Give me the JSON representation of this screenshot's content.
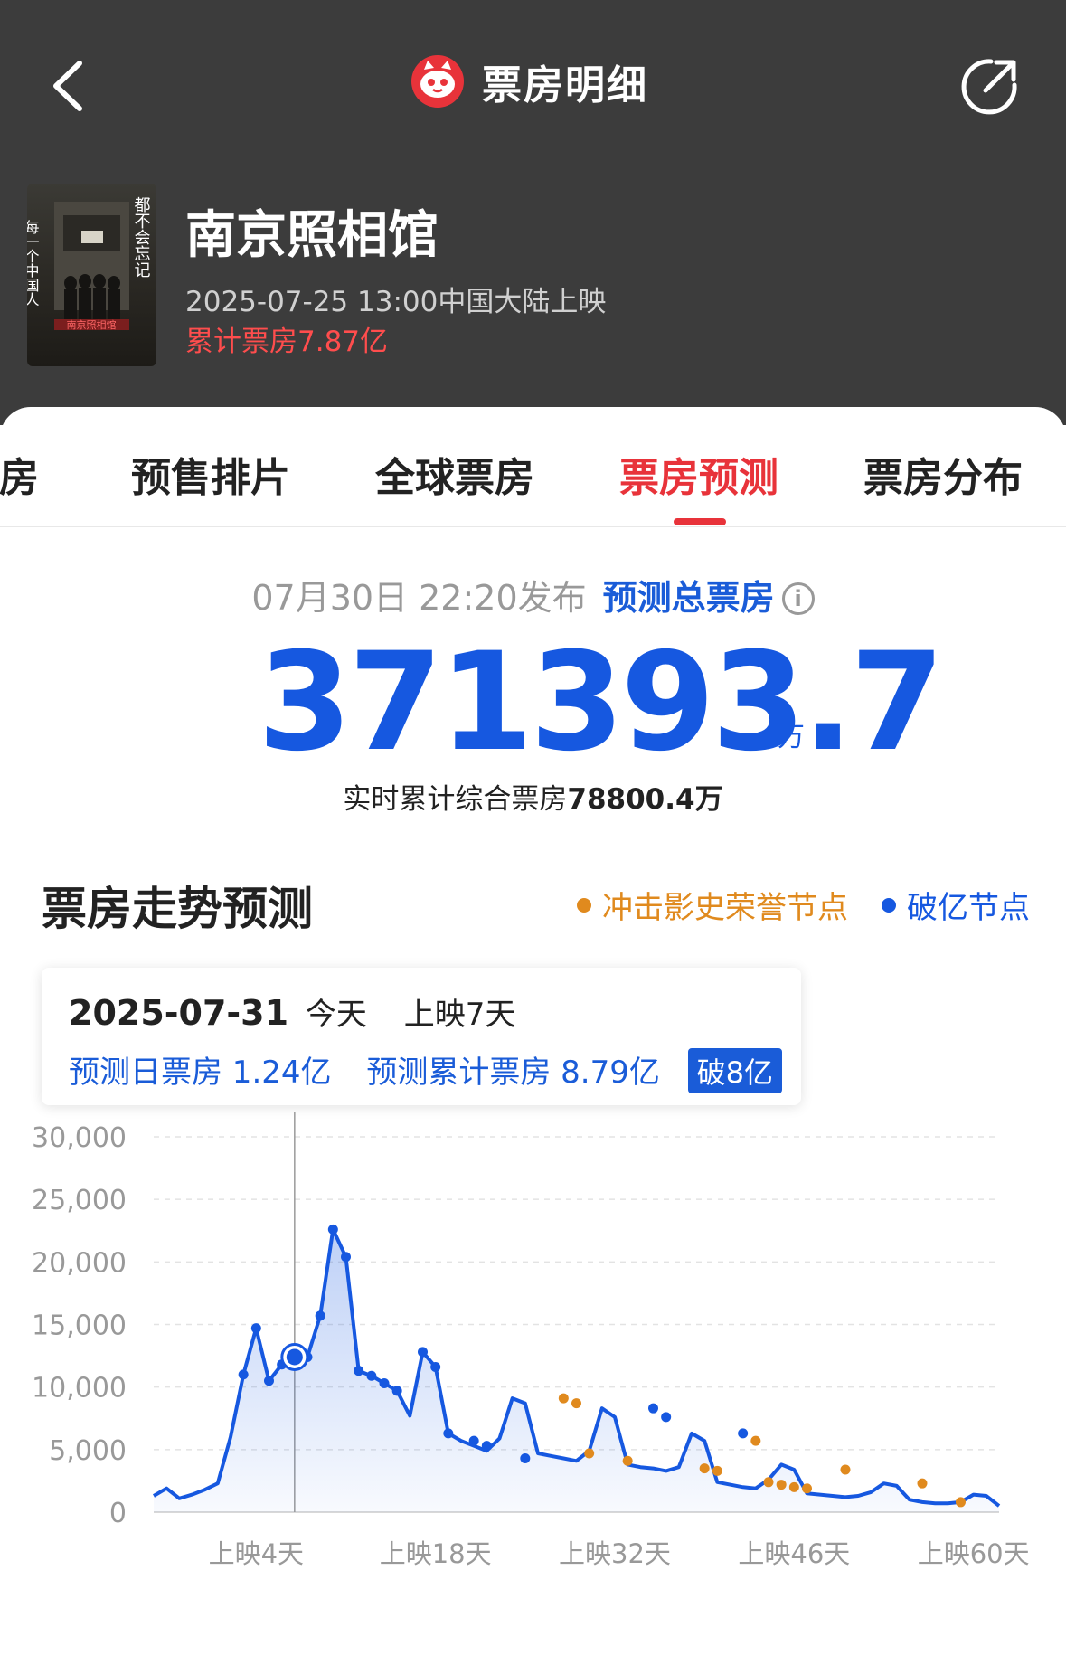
{
  "header": {
    "title": "票房明细"
  },
  "movie": {
    "title": "南京照相馆",
    "release": "2025-07-25 13:00中国大陆上映",
    "cumulative": "累计票房7.87亿",
    "poster_left": "每一个中国人",
    "poster_right": "都不会忘记"
  },
  "tabs": [
    {
      "label": "票房"
    },
    {
      "label": "预售排片"
    },
    {
      "label": "全球票房"
    },
    {
      "label": "票房预测"
    },
    {
      "label": "票房分布"
    }
  ],
  "forecast": {
    "published": "07月30日 22:20发布",
    "label": "预测总票房",
    "value": "371393.7",
    "unit": "万",
    "realtime_prefix": "实时累计综合票房",
    "realtime_value": "78800.4万"
  },
  "trend": {
    "title": "票房走势预测",
    "legend_orange": "冲击影史荣誉节点",
    "legend_blue": "破亿节点",
    "color_blue": "#1658e0",
    "color_orange": "#e08a1e"
  },
  "tooltip": {
    "date": "2025-07-31",
    "today": "今天",
    "day": "上映7天",
    "daily": "预测日票房 1.24亿",
    "cumulative": "预测累计票房 8.79亿",
    "badge": "破8亿"
  },
  "chart_data": {
    "type": "area",
    "ylim": [
      0,
      30000
    ],
    "y_ticks": [
      "0",
      "5,000",
      "10,000",
      "15,000",
      "20,000",
      "25,000",
      "30,000"
    ],
    "x_tick_labels": [
      "上映4天",
      "上映18天",
      "上映32天",
      "上映46天",
      "上映60天"
    ],
    "x_tick_days": [
      4,
      18,
      32,
      46,
      60
    ],
    "x": [
      -4,
      -3,
      -2,
      -1,
      0,
      1,
      2,
      3,
      4,
      5,
      6,
      7,
      8,
      9,
      10,
      11,
      12,
      13,
      14,
      15,
      16,
      17,
      18,
      19,
      20,
      21,
      22,
      23,
      24,
      25,
      26,
      27,
      28,
      29,
      30,
      31,
      32,
      33,
      34,
      35,
      36,
      37,
      38,
      39,
      40,
      41,
      42,
      43,
      44,
      45,
      46,
      47,
      48,
      49,
      50,
      51,
      52,
      53,
      54,
      55,
      56,
      57,
      58,
      59,
      60,
      61,
      62
    ],
    "values": [
      1300,
      1900,
      1100,
      1400,
      1800,
      2300,
      6000,
      11000,
      14700,
      10500,
      11800,
      12000,
      12400,
      15700,
      22600,
      20400,
      11300,
      10900,
      10300,
      9700,
      7700,
      12800,
      11600,
      6300,
      5700,
      5300,
      4900,
      5900,
      9100,
      8700,
      4700,
      4500,
      4300,
      4100,
      4900,
      8300,
      7600,
      3800,
      3600,
      3500,
      3300,
      3600,
      6300,
      5700,
      2400,
      2200,
      2000,
      1900,
      2600,
      3800,
      3400,
      1500,
      1400,
      1300,
      1200,
      1300,
      1600,
      2300,
      2100,
      1000,
      800,
      700,
      700,
      800,
      1400,
      1300,
      500
    ],
    "series": [
      {
        "name": "冲击影史荣誉节点",
        "x": [
          28,
          29,
          30,
          33,
          39,
          40,
          43,
          44,
          45,
          46,
          47,
          50,
          56,
          59
        ],
        "values": [
          9100,
          8700,
          4700,
          4100,
          3500,
          3300,
          5700,
          2400,
          2200,
          2000,
          1900,
          3400,
          2300,
          800
        ]
      },
      {
        "name": "破亿节点",
        "x": [
          3,
          4,
          5,
          6,
          8,
          9,
          10,
          11,
          12,
          13,
          14,
          15,
          17,
          18,
          19,
          21,
          22,
          25,
          35,
          36,
          42
        ],
        "values": [
          11000,
          14700,
          10500,
          11800,
          12400,
          15700,
          22600,
          20400,
          11300,
          10900,
          10300,
          9700,
          12800,
          11600,
          6300,
          5700,
          5300,
          4300,
          8300,
          7600,
          6300
        ]
      }
    ],
    "highlight_x": 7,
    "highlight_value": 12400
  }
}
